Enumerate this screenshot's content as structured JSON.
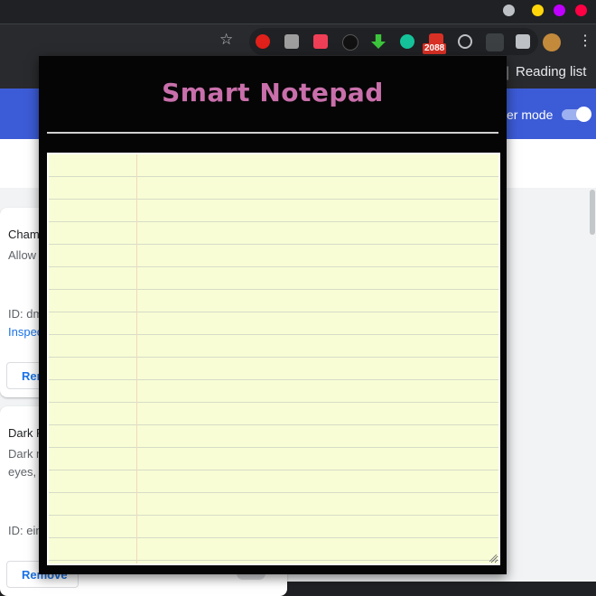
{
  "window": {
    "controls": [
      {
        "name": "minimize",
        "color": "#ffd60a"
      },
      {
        "name": "maximize",
        "color": "#bf00ff"
      },
      {
        "name": "close",
        "color": "#ff0044"
      }
    ]
  },
  "toolbar": {
    "bookmark_icon": "star-icon",
    "extensions": [
      {
        "name": "adblock-icon",
        "color": "#e0201a"
      },
      {
        "name": "touch-icon",
        "color": "#9e9e9e"
      },
      {
        "name": "pocket-icon",
        "color": "#ef3f56"
      },
      {
        "name": "cookie-icon",
        "color": "#111111"
      },
      {
        "name": "download-icon",
        "color": "#3cc43c"
      },
      {
        "name": "grammarly-icon",
        "color": "#15c39a"
      },
      {
        "name": "mail-icon",
        "color": "#d93025"
      },
      {
        "name": "gauge-icon",
        "color": "#bdc1c6"
      },
      {
        "name": "notepad-ext-icon",
        "color": "#e8eaed"
      },
      {
        "name": "puzzle-icon",
        "color": "#bdc1c6"
      }
    ],
    "mail_badge": "2088",
    "menu_icon": "kebab-menu-icon"
  },
  "bookmarks": {
    "reading_list": "Reading list"
  },
  "header": {
    "dev_mode_label": "er mode",
    "accent": "#3c5bd6"
  },
  "cards": [
    {
      "name": "Cham",
      "desc": "Allow",
      "id_line": "ID: dm",
      "inspect": "Inspec",
      "remove": "Rem"
    },
    {
      "name": "Dark R",
      "desc1": "Dark m",
      "desc2": "eyes, r",
      "id_line": "ID: ein",
      "remove": "Remove"
    }
  ],
  "popup": {
    "title": "Smart Notepad",
    "title_color": "#c96fab",
    "note_value": "",
    "paper_color": "#f8fdd5"
  }
}
